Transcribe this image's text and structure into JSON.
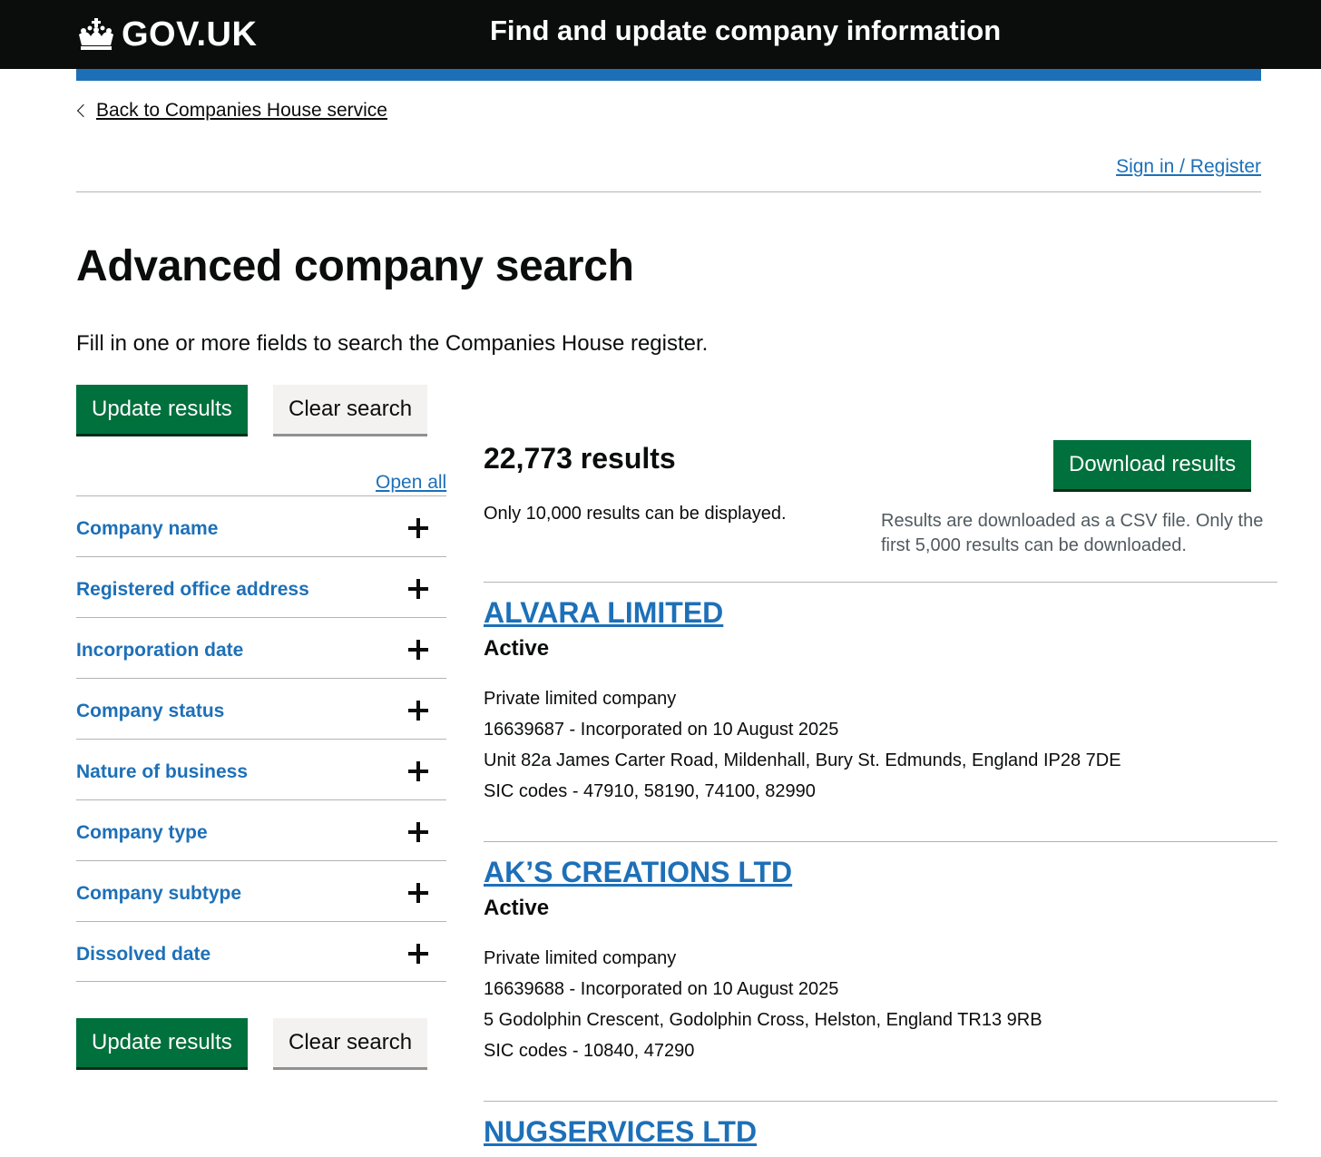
{
  "header": {
    "logo_text": "GOV.UK",
    "service_name": "Find and update company information"
  },
  "nav": {
    "back_link": "Back to Companies House service",
    "sign_in": "Sign in / Register"
  },
  "page": {
    "title": "Advanced company search",
    "lede": "Fill in one or more fields to search the Companies House register."
  },
  "buttons": {
    "update_results": "Update results",
    "clear_search": "Clear search",
    "download_results": "Download results"
  },
  "filters": {
    "open_all": "Open all",
    "items": [
      {
        "label": "Company name"
      },
      {
        "label": "Registered office address"
      },
      {
        "label": "Incorporation date"
      },
      {
        "label": "Company status"
      },
      {
        "label": "Nature of business"
      },
      {
        "label": "Company type"
      },
      {
        "label": "Company subtype"
      },
      {
        "label": "Dissolved date"
      }
    ]
  },
  "results": {
    "count": "22,773 results",
    "display_note": "Only 10,000 results can be displayed.",
    "download_note": "Results are downloaded as a CSV file. Only the first 5,000 results can be downloaded.",
    "items": [
      {
        "name": "ALVARA LIMITED",
        "status": "Active",
        "type": "Private limited company",
        "number_line": "16639687 - Incorporated on 10 August 2025",
        "address": "Unit 82a James Carter Road, Mildenhall, Bury St. Edmunds, England IP28 7DE",
        "sic": "SIC codes - 47910, 58190, 74100, 82990"
      },
      {
        "name": "AK’S CREATIONS LTD",
        "status": "Active",
        "type": "Private limited company",
        "number_line": "16639688 - Incorporated on 10 August 2025",
        "address": "5 Godolphin Crescent, Godolphin Cross, Helston, England TR13 9RB",
        "sic": "SIC codes - 10840, 47290"
      },
      {
        "name": "NUGSERVICES LTD"
      }
    ]
  },
  "colors": {
    "header_bg": "#0b0c0c",
    "brand_blue": "#1d70b8",
    "button_green": "#00703c",
    "secondary_button": "#f3f2f1"
  }
}
